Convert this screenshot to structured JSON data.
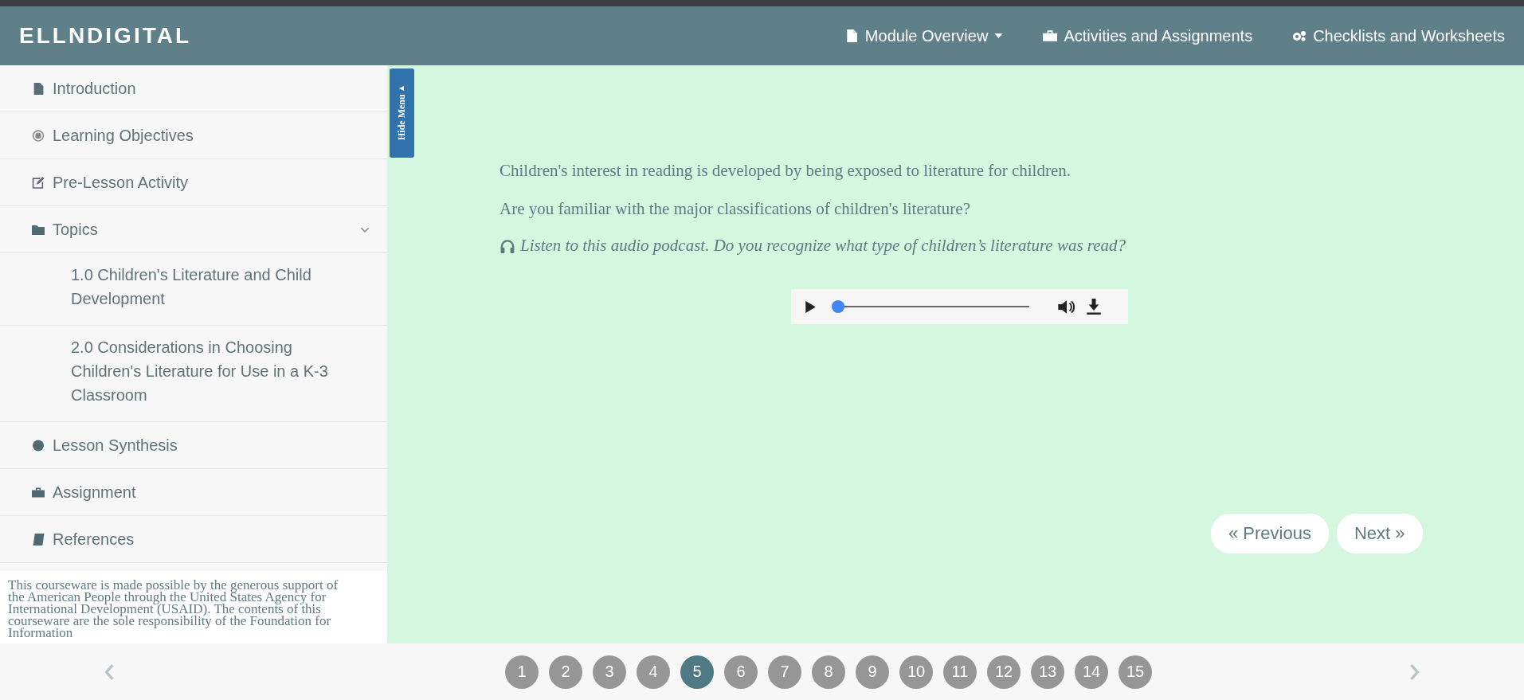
{
  "header": {
    "logo": "ELLNDIGITAL",
    "nav": [
      {
        "label": "Module Overview"
      },
      {
        "label": "Activities and Assignments"
      },
      {
        "label": "Checklists and Worksheets"
      }
    ]
  },
  "sidebar": {
    "items": [
      {
        "label": "Introduction"
      },
      {
        "label": "Learning Objectives"
      },
      {
        "label": "Pre-Lesson Activity"
      },
      {
        "label": "Topics",
        "expanded": true,
        "children": [
          {
            "label": "1.0 Children's Literature and Child Development"
          },
          {
            "label": "2.0 Considerations in Choosing Children's Literature for Use in a K-3 Classroom"
          }
        ]
      },
      {
        "label": "Lesson Synthesis"
      },
      {
        "label": "Assignment"
      },
      {
        "label": "References"
      }
    ],
    "disclaimer": "This courseware is made possible by the generous support of the American People through the United States Agency for International Development (USAID). The contents of this courseware are the sole responsibility of the Foundation for Information"
  },
  "hide_menu": "Hide Menu",
  "content": {
    "paragraphs": [
      "Children's interest in reading is developed by being exposed to literature for children.",
      "Are you familiar with the major classifications of children's literature?"
    ],
    "prompt": "Listen to this audio podcast. Do you recognize what type of children’s literature was read?",
    "audio": {
      "level": 0.0
    },
    "buttons": [
      "« Previous",
      "Next »"
    ]
  },
  "pages": [
    {
      "label": "1",
      "selected": false
    },
    {
      "label": "2",
      "selected": false
    },
    {
      "label": "3",
      "selected": false
    },
    {
      "label": "4",
      "selected": false
    },
    {
      "label": "5",
      "selected": true
    },
    {
      "label": "6",
      "selected": false
    },
    {
      "label": "7",
      "selected": false
    },
    {
      "label": "8",
      "selected": false
    },
    {
      "label": "9",
      "selected": false
    },
    {
      "label": "10",
      "selected": false
    },
    {
      "label": "11",
      "selected": false
    },
    {
      "label": "12",
      "selected": false
    },
    {
      "label": "13",
      "selected": false
    },
    {
      "label": "14",
      "selected": false
    },
    {
      "label": "15",
      "selected": false
    }
  ]
}
